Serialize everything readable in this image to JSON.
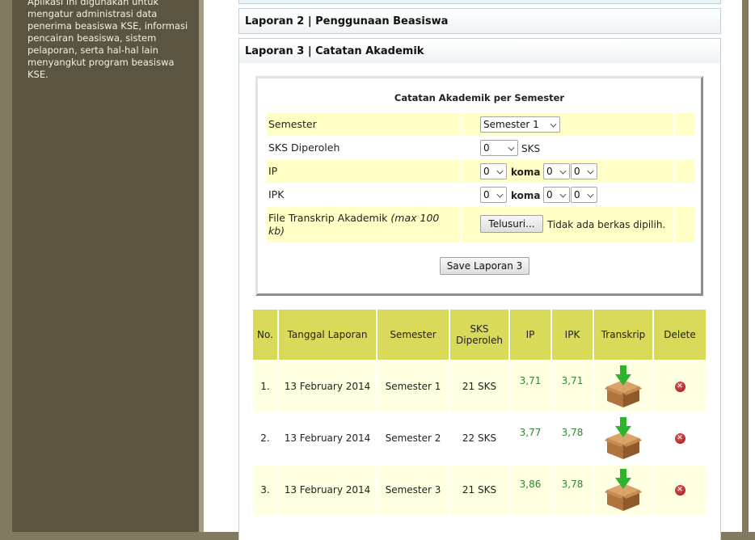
{
  "sidebar": {
    "description": "Aplikasi ini digunakan untuk mengatur administrasi data penerima beasiswa KSE, informasi pencairan beasiswa, sistem pelaporan, serta hal-hal lain menyangkut program beasiswa KSE."
  },
  "accordion": {
    "laporan2": "Laporan 2 | Penggunaan Beasiswa",
    "laporan3": "Laporan 3 | Catatan Akademik"
  },
  "form": {
    "title": "Catatan Akademik per Semester",
    "semester_label": "Semester",
    "semester_value": "Semester 1",
    "sks_label": "SKS Diperoleh",
    "sks_value": "0",
    "sks_unit": "SKS",
    "ip_label": "IP",
    "ip_int": "0",
    "ip_koma": "koma",
    "ip_dec1": "0",
    "ip_dec2": "0",
    "ipk_label": "IPK",
    "ipk_int": "0",
    "ipk_koma": "koma",
    "ipk_dec1": "0",
    "ipk_dec2": "0",
    "file_label": "File Transkrip Akademik",
    "file_hint": "(max 100 kb)",
    "browse_button": "Telusuri...",
    "no_file": "Tidak ada berkas dipilih.",
    "save_button": "Save Laporan 3"
  },
  "table": {
    "headers": {
      "no": "No.",
      "tanggal": "Tanggal Laporan",
      "semester": "Semester",
      "sks": "SKS Diperoleh",
      "ip": "IP",
      "ipk": "IPK",
      "transkrip": "Transkrip",
      "delete": "Delete"
    },
    "rows": [
      {
        "no": "1.",
        "tanggal": "13 February 2014",
        "semester": "Semester 1",
        "sks": "21 SKS",
        "ip": "3,71",
        "ipk": "3,71"
      },
      {
        "no": "2.",
        "tanggal": "13 February 2014",
        "semester": "Semester 2",
        "sks": "22 SKS",
        "ip": "3,77",
        "ipk": "3,78"
      },
      {
        "no": "3.",
        "tanggal": "13 February 2014",
        "semester": "Semester 3",
        "sks": "21 SKS",
        "ip": "3,86",
        "ipk": "3,78"
      }
    ]
  },
  "icons": {
    "download": "download-box-icon",
    "delete": "delete-icon"
  },
  "colors": {
    "sidebar_bg": "#5b5440",
    "frame_bg": "#827a60",
    "form_row_bg": "#ffffc6",
    "table_header_bg": "#d9d95a",
    "table_row_bg": "#ffffe2",
    "ip_text": "#2c8a2c",
    "delete_red": "#c0392b"
  }
}
